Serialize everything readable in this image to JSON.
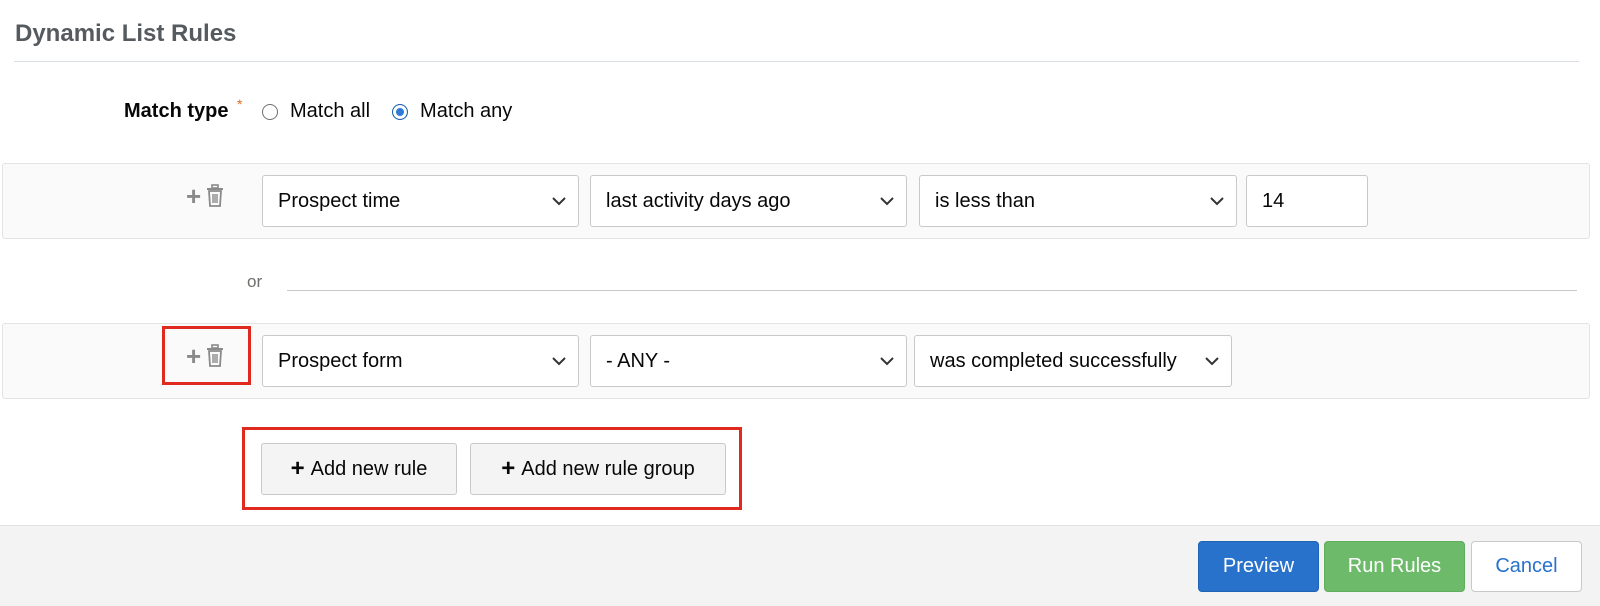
{
  "header": {
    "title": "Dynamic List Rules"
  },
  "match": {
    "label": "Match type",
    "required_marker": "*",
    "options": [
      {
        "label": "Match all",
        "checked": false
      },
      {
        "label": "Match any",
        "checked": true
      }
    ]
  },
  "rules": [
    {
      "field": "Prospect time",
      "operator": "last activity days ago",
      "condition": "is less than",
      "value": "14"
    },
    {
      "field": "Prospect form",
      "operator": "- ANY -",
      "condition": "was completed successfully"
    }
  ],
  "separator": {
    "label": "or"
  },
  "actions": {
    "add_rule_label": "Add new rule",
    "add_group_label": "Add new rule group",
    "plus_glyph": "+"
  },
  "footer": {
    "preview_label": "Preview",
    "run_label": "Run Rules",
    "cancel_label": "Cancel"
  },
  "colors": {
    "primary": "#2872cc",
    "success": "#6dba6b",
    "highlight": "#e0291f",
    "required": "#e26c21"
  },
  "icons": [
    "plus-icon",
    "trash-icon",
    "chevron-down-icon"
  ]
}
